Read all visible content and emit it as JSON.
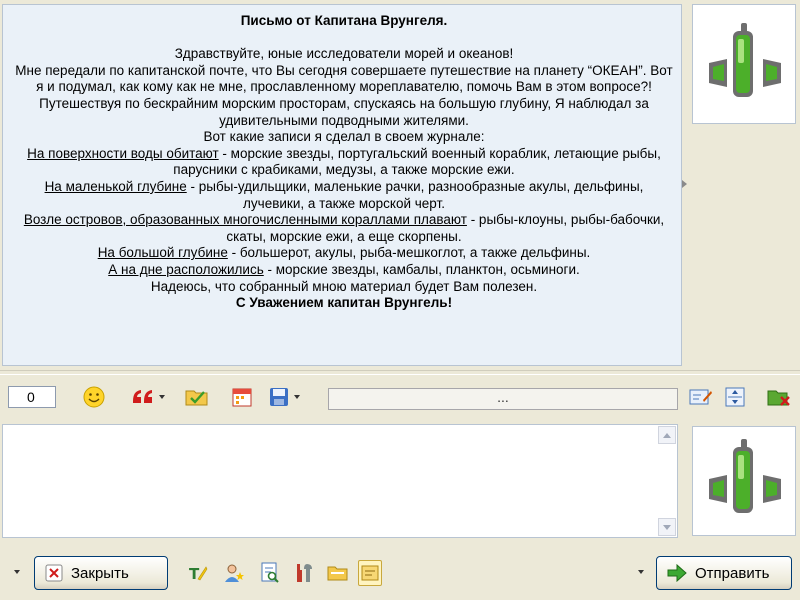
{
  "history": {
    "title": "Письмо от Капитана Врунгеля.",
    "greeting": "Здравствуйте, юные исследователи морей и океанов!",
    "p1": "Мне передали по капитанской почте, что Вы сегодня совершаете путешествие на планету “ОКЕАН”. Вот я и подумал, как кому как не мне, прославленному мореплавателю, помочь Вам в этом вопросе?!",
    "p2": "Путешествуя по бескрайним морским просторам, спускаясь на большую глубину, Я наблюдал за удивительными подводными жителями.",
    "p3": "Вот какие записи я сделал в своем журнале:",
    "e1_label": "На поверхности воды обитают",
    "e1_text": " - морские звезды, португальский военный кораблик, летающие рыбы, парусники с крабиками, медузы, а также морские ежи.",
    "e2_label": "На маленькой глубине",
    "e2_text": " - рыбы-удильщики, маленькие рачки, разнообразные акулы, дельфины, лучевики, а также морской черт.",
    "e3_label": "Возле островов, образованных многочисленными кораллами плавают",
    "e3_text": " - рыбы-клоуны, рыбы-бабочки, скаты, морские ежи, а еще скорпены.",
    "e4_label": "На большой глубине",
    "e4_text": " - большерот, акулы, рыба-мешкоглот, а также дельфины.",
    "e5_label": "А на  дне расположились",
    "e5_text": " - морские звезды, камбалы, планктон, осьминоги.",
    "closing": "Надеюсь, что собранный мною материал будет Вам полезен.",
    "signature": "С Уважением капитан Врунгель!"
  },
  "toolbar": {
    "counter": "0",
    "status_text": "...",
    "icons": [
      "smiley-icon",
      "quote-icon",
      "folder-check-icon",
      "calendar-icon",
      "save-disk-icon",
      "edit-card-icon",
      "split-view-icon",
      "close-folder-icon"
    ]
  },
  "input": {
    "value": "",
    "placeholder": ""
  },
  "buttons": {
    "close_label": "Закрыть",
    "send_label": "Отправить"
  },
  "colors": {
    "history_bg": "#eaf1f8",
    "window_bg": "#ece9d8",
    "avatar_green": "#4caf2a"
  }
}
